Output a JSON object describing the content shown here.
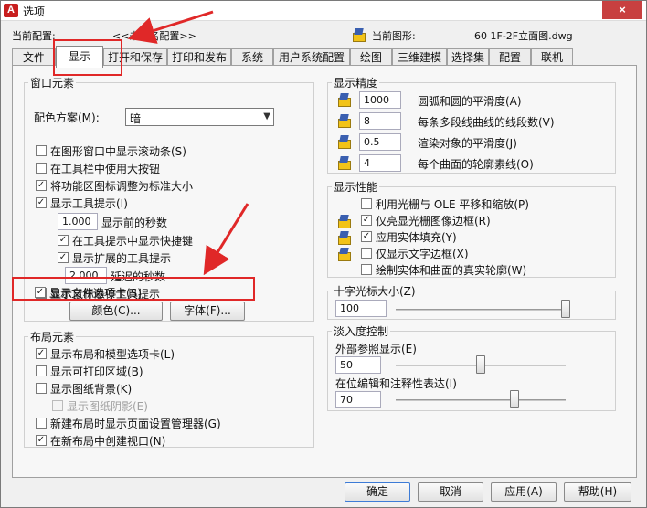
{
  "window": {
    "logo": "A",
    "title": "选项",
    "close": "×"
  },
  "current": {
    "profile_label": "当前配置:",
    "profile_value": "<<未命名配置>>",
    "drawing_label": "当前图形:",
    "drawing_value": "60 1F-2F立面图.dwg"
  },
  "tabs": [
    "文件",
    "显示",
    "打开和保存",
    "打印和发布",
    "系统",
    "用户系统配置",
    "绘图",
    "三维建模",
    "选择集",
    "配置",
    "联机"
  ],
  "active_tab": "显示",
  "window_elements": {
    "title": "窗口元素",
    "color_scheme_label": "配色方案(M):",
    "color_scheme_value": "暗",
    "options": [
      {
        "label": "在图形窗口中显示滚动条(S)",
        "checked": false
      },
      {
        "label": "在工具栏中使用大按钮",
        "checked": false
      },
      {
        "label": "将功能区图标调整为标准大小",
        "checked": true
      },
      {
        "label": "显示工具提示(I)",
        "checked": true
      }
    ],
    "tooltip_delay_value": "1.000",
    "tooltip_delay_label": "显示前的秒数",
    "sub_options": [
      {
        "label": "在工具提示中显示快捷键",
        "checked": true
      },
      {
        "label": "显示扩展的工具提示",
        "checked": true
      }
    ],
    "extended_delay_value": "2.000",
    "extended_delay_label": "延迟的秒数",
    "more_options": [
      {
        "label": "显示鼠标悬停工具提示",
        "checked": false
      },
      {
        "label": "显示文件选项卡(S)",
        "checked": true
      }
    ],
    "colors_button": "颜色(C)...",
    "fonts_button": "字体(F)..."
  },
  "layout_elements": {
    "title": "布局元素",
    "options": [
      {
        "label": "显示布局和模型选项卡(L)",
        "checked": true,
        "disabled": false
      },
      {
        "label": "显示可打印区域(B)",
        "checked": false,
        "disabled": false
      },
      {
        "label": "显示图纸背景(K)",
        "checked": false,
        "disabled": false
      },
      {
        "label": "显示图纸阴影(E)",
        "checked": false,
        "disabled": true
      },
      {
        "label": "新建布局时显示页面设置管理器(G)",
        "checked": false,
        "disabled": false
      },
      {
        "label": "在新布局中创建视口(N)",
        "checked": true,
        "disabled": false
      }
    ]
  },
  "display_resolution": {
    "title": "显示精度",
    "items": [
      {
        "value": "1000",
        "label": "圆弧和圆的平滑度(A)"
      },
      {
        "value": "8",
        "label": "每条多段线曲线的线段数(V)"
      },
      {
        "value": "0.5",
        "label": "渲染对象的平滑度(J)"
      },
      {
        "value": "4",
        "label": "每个曲面的轮廓素线(O)"
      }
    ]
  },
  "display_performance": {
    "title": "显示性能",
    "options": [
      {
        "label": "利用光栅与 OLE 平移和缩放(P)",
        "checked": false
      },
      {
        "label": "仅亮显光栅图像边框(R)",
        "checked": true
      },
      {
        "label": "应用实体填充(Y)",
        "checked": true
      },
      {
        "label": "仅显示文字边框(X)",
        "checked": false
      },
      {
        "label": "绘制实体和曲面的真实轮廓(W)",
        "checked": false
      }
    ]
  },
  "crosshair": {
    "title": "十字光标大小(Z)",
    "value": "100",
    "slider_fraction": 1.0
  },
  "fade_control": {
    "title": "淡入度控制",
    "xref_label": "外部参照显示(E)",
    "xref_value": "50",
    "xref_fraction": 0.5,
    "inplace_label": "在位编辑和注释性表达(I)",
    "inplace_value": "70",
    "inplace_fraction": 0.7
  },
  "footer": {
    "ok": "确定",
    "cancel": "取消",
    "apply": "应用(A)",
    "help": "帮助(H)"
  },
  "colors": {
    "annotation": "#e02828",
    "title_close": "#c84040",
    "logo": "#c81e1e"
  }
}
